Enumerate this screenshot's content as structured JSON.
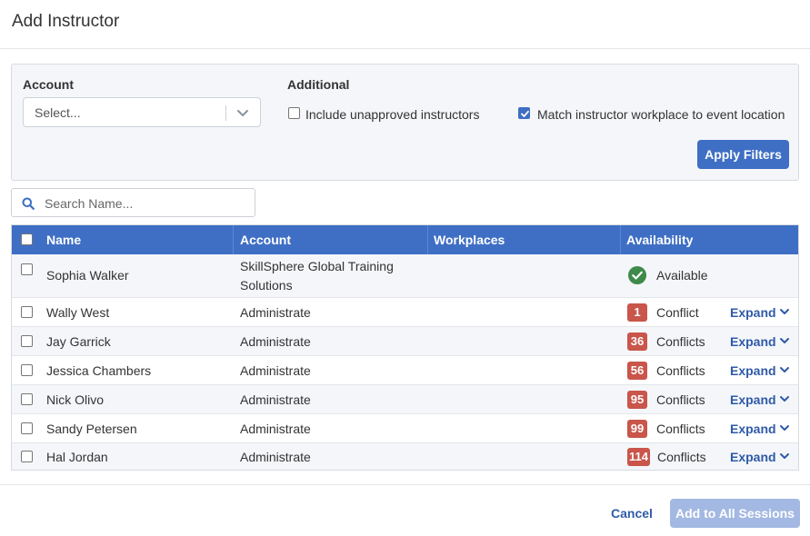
{
  "modal": {
    "title": "Add Instructor"
  },
  "filters": {
    "account_label": "Account",
    "account_select": {
      "value": "Select..."
    },
    "additional_label": "Additional",
    "include_unapproved": {
      "label": "Include unapproved instructors",
      "checked": false
    },
    "match_workplace": {
      "label": "Match instructor workplace to event location",
      "checked": true
    },
    "apply_label": "Apply Filters"
  },
  "search": {
    "placeholder": "Search Name..."
  },
  "table": {
    "columns": [
      "Name",
      "Account",
      "Workplaces",
      "Availability"
    ],
    "expand_label": "Expand",
    "rows": [
      {
        "name": "Sophia Walker",
        "account_line1": "SkillSphere Global Training",
        "account_line2": "Solutions",
        "workplaces": "",
        "status": "Available"
      },
      {
        "name": "Wally West",
        "account": "Administrate",
        "workplaces": "",
        "count": "1",
        "status": "Conflict"
      },
      {
        "name": "Jay Garrick",
        "account": "Administrate",
        "workplaces": "",
        "count": "36",
        "status": "Conflicts"
      },
      {
        "name": "Jessica Chambers",
        "account": "Administrate",
        "workplaces": "",
        "count": "56",
        "status": "Conflicts"
      },
      {
        "name": "Nick Olivo",
        "account": "Administrate",
        "workplaces": "",
        "count": "95",
        "status": "Conflicts"
      },
      {
        "name": "Sandy Petersen",
        "account": "Administrate",
        "workplaces": "",
        "count": "99",
        "status": "Conflicts"
      },
      {
        "name": "Hal Jordan",
        "account": "Administrate",
        "workplaces": "",
        "count": "114",
        "status": "Conflicts"
      }
    ]
  },
  "footer": {
    "cancel_label": "Cancel",
    "add_label": "Add to All Sessions"
  },
  "colors": {
    "primary": "#3f6fc4",
    "conflict": "#c9554b",
    "available": "#3e8a4a",
    "link": "#2f5aa8"
  }
}
